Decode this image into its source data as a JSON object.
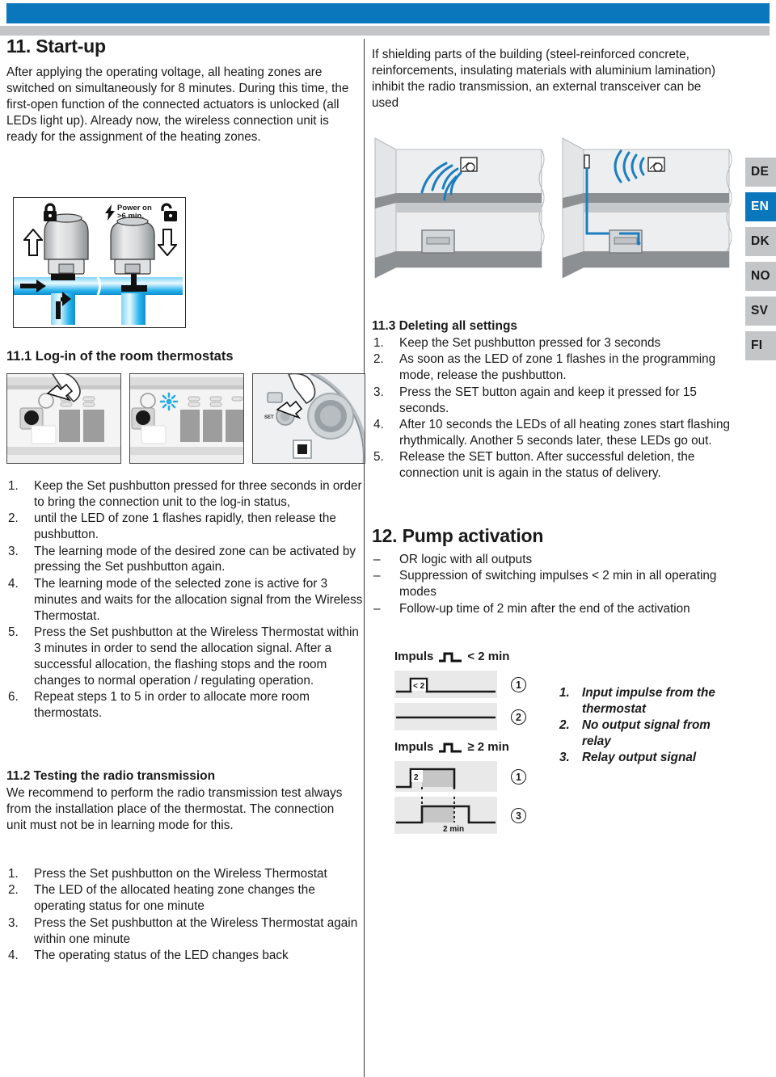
{
  "banner": {
    "accent_color": "#0a76bc",
    "grey_color": "#c3c5c7"
  },
  "language_tabs": [
    {
      "code": "DE",
      "active": false
    },
    {
      "code": "EN",
      "active": true
    },
    {
      "code": "DK",
      "active": false
    },
    {
      "code": "NO",
      "active": false
    },
    {
      "code": "SV",
      "active": false
    },
    {
      "code": "FI",
      "active": false
    }
  ],
  "left_column": {
    "section_11": {
      "heading": "11. Start-up",
      "paragraph": "After applying the operating voltage, all heating zones are switched on simultaneously for 8 minutes. During this time, the first-open function of the connected actuators is unlocked (all LEDs light up). Already now, the wireless connection unit is ready for the assignment of the heating zones."
    },
    "actuator_figure": {
      "power_label_line1": "Power on",
      "power_label_line2": ">6 min.",
      "lock_closed_icon": "lock-closed-icon",
      "lock_open_icon": "lock-open-icon",
      "bolt_icon": "lightning-bolt-icon"
    },
    "section_11_1": {
      "heading": "11.1 Log-in of the room thermostats",
      "steps": [
        {
          "num": "1.",
          "text": "Keep the Set pushbutton pressed for three seconds in order to bring the connection unit to the log-in status,"
        },
        {
          "num": "2.",
          "text": "until the LED of zone 1 flashes rapidly, then release the pushbutton."
        },
        {
          "num": "3.",
          "text": "The learning mode of the desired zone can be activated by pressing the Set pushbutton again."
        },
        {
          "num": "4.",
          "text": "The learning mode of the selected zone is active for 3 minutes and waits for the allocation signal from the Wireless Thermostat."
        },
        {
          "num": "5.",
          "text": "Press the Set pushbutton at the Wireless Thermostat within 3 minutes in order to send the allocation signal. After a successful allocation, the flashing stops and the room changes to normal operation / regulating operation."
        },
        {
          "num": "6.",
          "text": "Repeat steps 1 to 5 in order to allocate more room thermostats."
        }
      ],
      "photo_set_label": "SET"
    },
    "section_11_2": {
      "heading": "11.2  Testing the radio transmission",
      "paragraph": "We recommend to perform the radio transmission test always from the installation place of the thermostat. The connection unit must not be in learning mode for this.",
      "steps": [
        {
          "num": "1.",
          "text": "Press the Set pushbutton on the Wireless Thermostat"
        },
        {
          "num": "2.",
          "text": "The LED of the allocated heating zone changes the operating status for one minute"
        },
        {
          "num": "3.",
          "text": "Press the Set pushbutton at the Wireless Thermostat again within one minute"
        },
        {
          "num": "4.",
          "text": "The operating status of the LED changes back"
        }
      ]
    }
  },
  "right_column": {
    "intro_paragraph": "If shielding parts of the building (steel-reinforced concrete, reinforcements, insulating materials with aluminium lamination) inhibit the radio transmission, an external transceiver can be used",
    "section_11_3": {
      "heading": "11.3 Deleting all settings",
      "steps": [
        {
          "num": "1.",
          "text": "Keep the Set pushbutton pressed for 3 seconds"
        },
        {
          "num": "2.",
          "text": "As soon as the LED of zone 1 flashes in the programming mode, release the pushbutton."
        },
        {
          "num": "3.",
          "text": "Press the SET button again and keep it pressed for 15 seconds."
        },
        {
          "num": "4.",
          "text": "After 10 seconds the LEDs of all heating zones start flashing rhythmically. Another 5 seconds later, these LEDs go out."
        },
        {
          "num": "5.",
          "text": "Release the SET button. After successful deletion, the connection unit is again in the status of delivery."
        }
      ]
    },
    "section_12": {
      "heading": "12. Pump activation",
      "bullets": [
        {
          "mark": "–",
          "text": "OR logic with all outputs"
        },
        {
          "mark": "–",
          "text": "Suppression of switching impulses < 2 min in all operating modes"
        },
        {
          "mark": "–",
          "text": "Follow-up time of 2 min after the end of the activation"
        }
      ]
    },
    "pump_diagram": {
      "group_a": {
        "title_prefix": "Impuls",
        "title_suffix": "< 2 min",
        "trace1_label": "< 2",
        "trace1_badge": "1",
        "trace2_badge": "2"
      },
      "group_b": {
        "title_prefix": "Impuls",
        "title_suffix": "≥ 2 min",
        "trace1_label": "2",
        "trace1_badge": "1",
        "trace2_badge": "3",
        "trace2_axis_label": "2 min"
      },
      "legend": [
        {
          "num": "1.",
          "text": "Input impulse from the thermostat"
        },
        {
          "num": "2.",
          "text": "No output signal from relay"
        },
        {
          "num": "3.",
          "text": "Relay output signal"
        }
      ]
    }
  }
}
